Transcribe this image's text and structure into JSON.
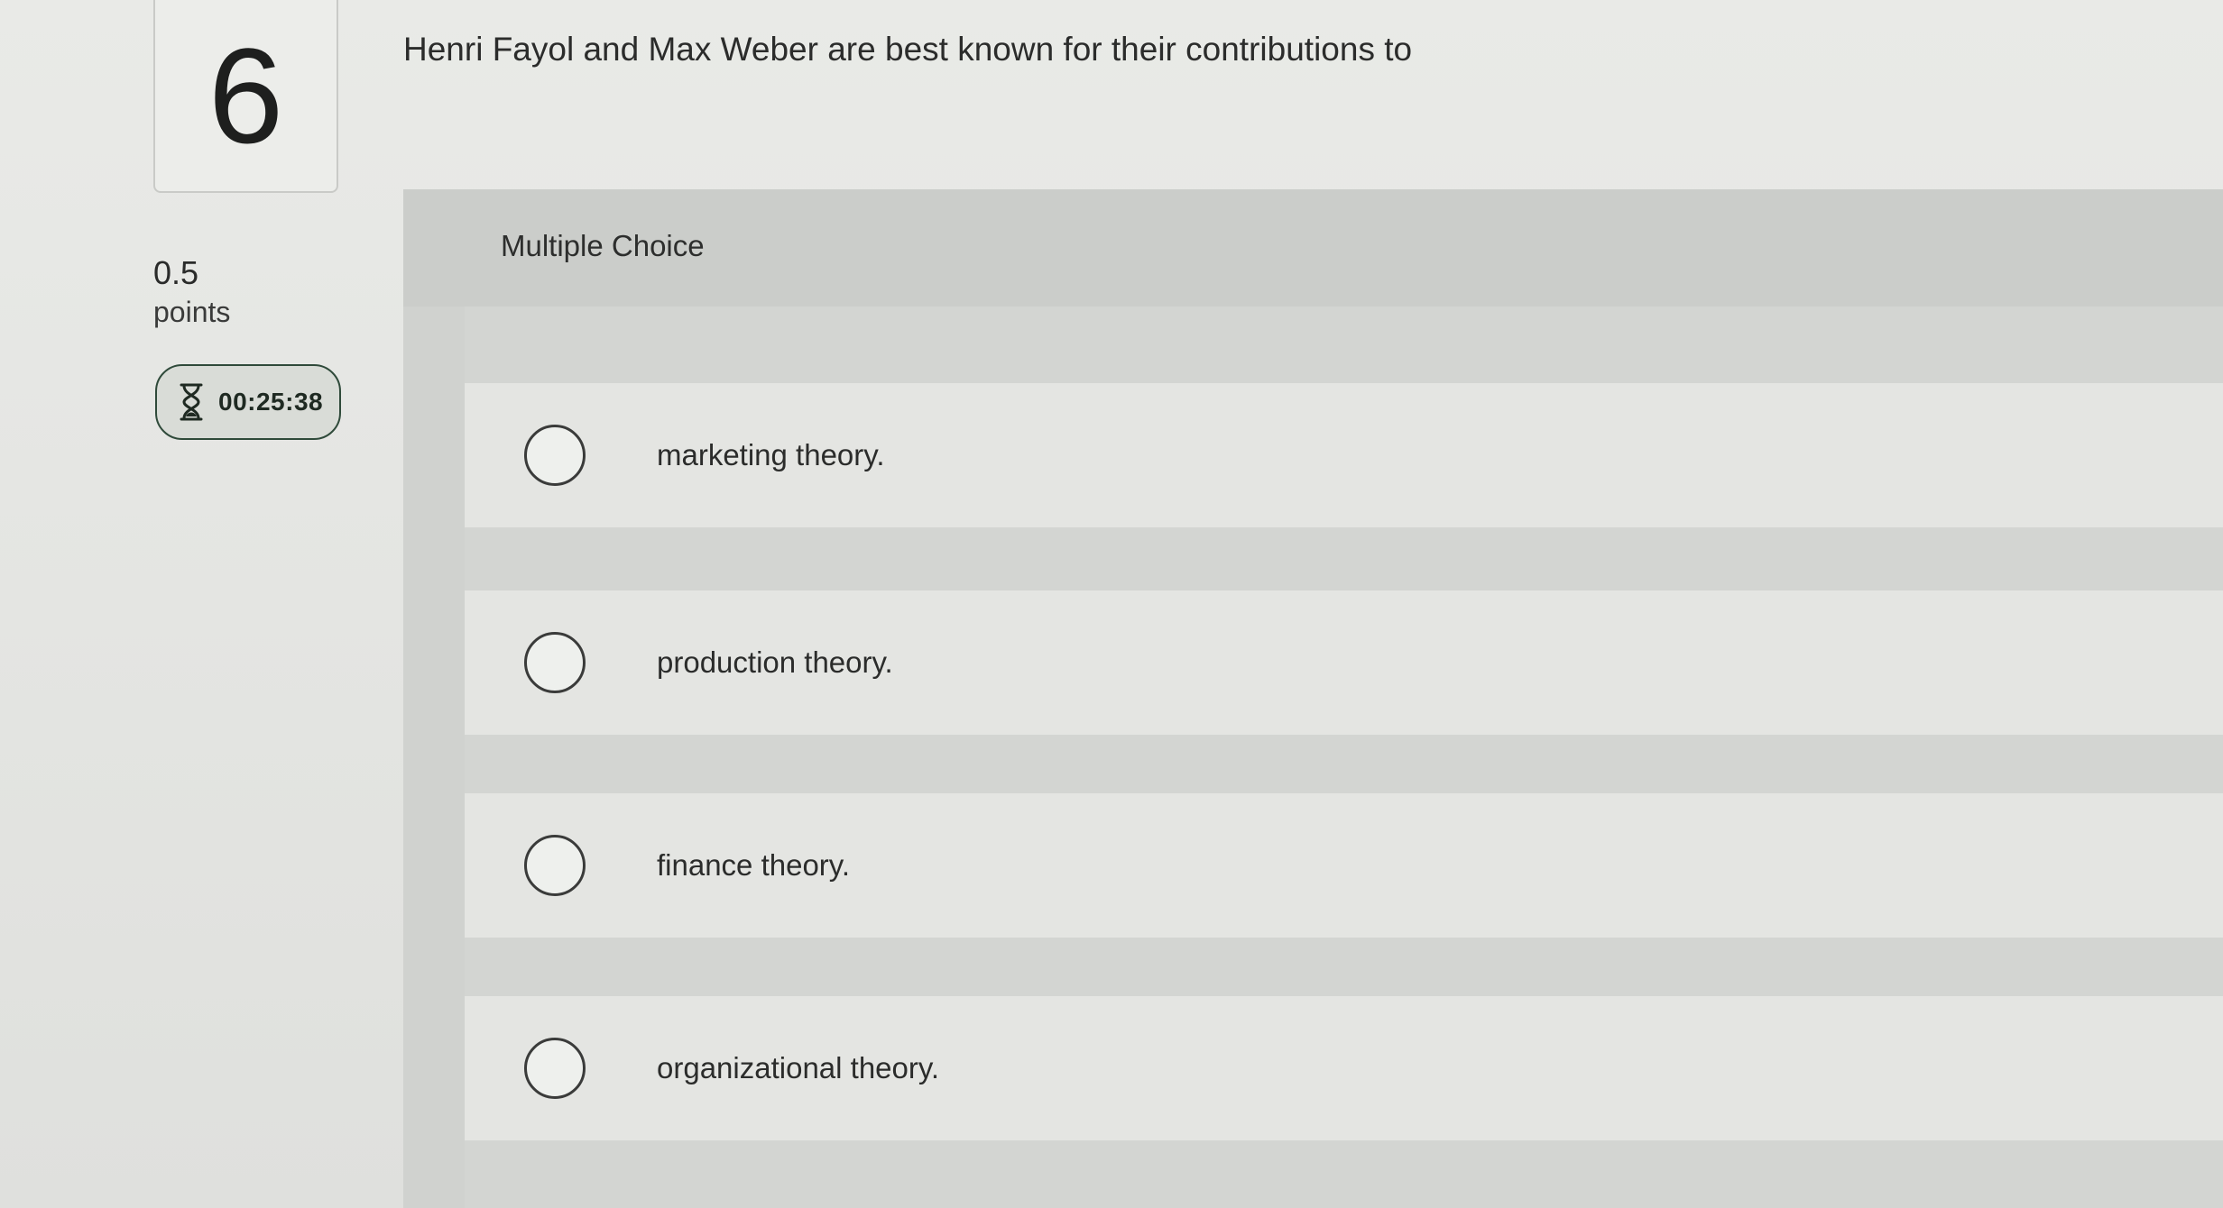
{
  "question": {
    "number": "6",
    "text": "Henri Fayol and Max Weber are best known for their contributions to",
    "points_value": "0.5",
    "points_label": "points",
    "timer": "00:25:38",
    "type_label": "Multiple Choice"
  },
  "options": [
    {
      "label": "marketing theory."
    },
    {
      "label": "production theory."
    },
    {
      "label": "finance theory."
    },
    {
      "label": "organizational theory."
    }
  ],
  "icons": {
    "timer": "hourglass-icon",
    "option": "radio-circle"
  }
}
